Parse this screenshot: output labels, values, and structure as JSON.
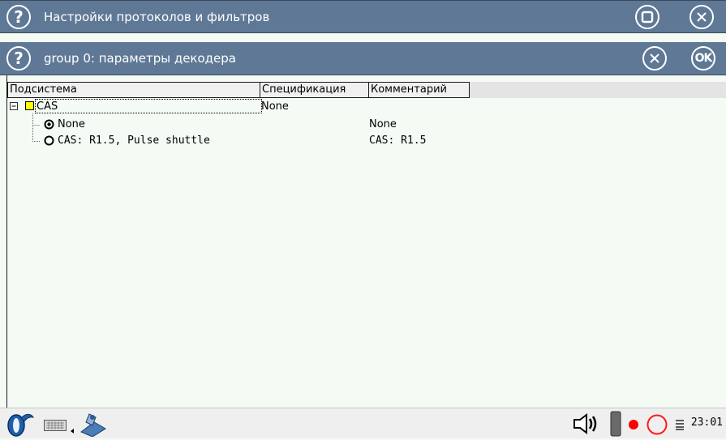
{
  "window": {
    "title": "Настройки протоколов и фильтров"
  },
  "dialog": {
    "title": "group 0: параметры декодера",
    "ok_label": "OK"
  },
  "table": {
    "columns": [
      "Подсистема",
      "Спецификация",
      "Комментарий"
    ],
    "group": {
      "label": "CAS",
      "spec": "None",
      "color": "#ffff00"
    },
    "options": [
      {
        "label": "None",
        "comment": "None",
        "selected": true
      },
      {
        "label": "CAS: R1.5, Pulse shuttle",
        "comment": "CAS: R1.5",
        "selected": false
      }
    ]
  },
  "taskbar": {
    "time": "23:01",
    "record_color": "#ff0000"
  },
  "colors": {
    "titlebar": "#5f7896",
    "background": "#f4faf4"
  }
}
